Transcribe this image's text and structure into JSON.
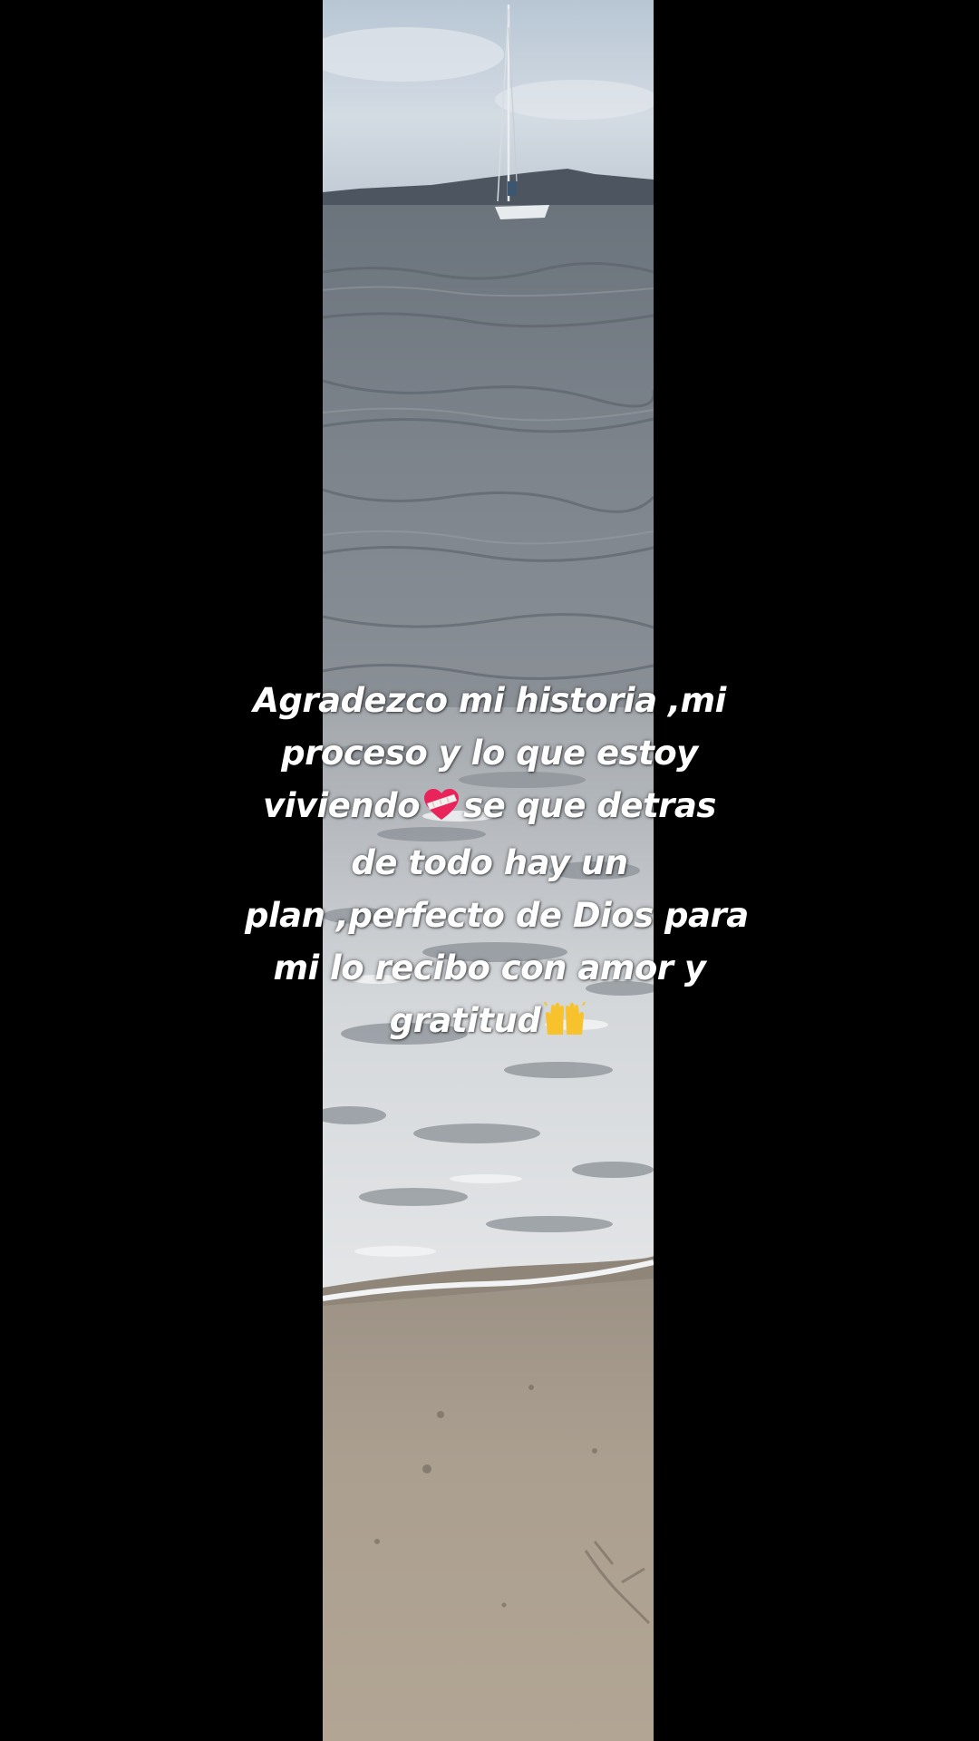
{
  "caption": {
    "lines": [
      "Agradezco mi historia ,mi",
      "proceso y lo que estoy",
      "viviendo",
      "se que detras",
      "de todo hay un",
      "plan ,perfecto de Dios para",
      "mi lo recibo con amor y",
      "gratitud"
    ],
    "emoji_1": "bandaged-heart-icon",
    "emoji_2": "raising-hands-icon"
  },
  "colors": {
    "background": "#000000",
    "sky": "#c9d3dd",
    "sea": "#7b828a",
    "foam": "#e8eaec",
    "sand": "#a89c8d",
    "text": "#ffffff"
  }
}
